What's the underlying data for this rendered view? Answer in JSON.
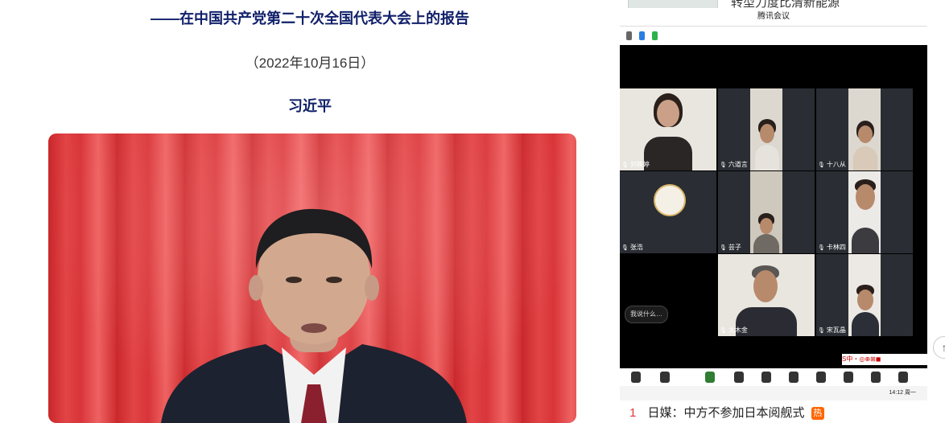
{
  "article": {
    "subtitle": "——在中国共产党第二十次全国代表大会上的报告",
    "date": "（2022年10月16日）",
    "author": "习近平"
  },
  "sidebar_news_top": {
    "title": "转型力度比清新能源"
  },
  "meeting": {
    "window_title": "腾讯会议",
    "participants": [
      {
        "name": "刘筱婷"
      },
      {
        "name": "六道言"
      },
      {
        "name": "十八从"
      },
      {
        "name": "张浩"
      },
      {
        "name": "芸子"
      },
      {
        "name": "卡林四"
      },
      {
        "name": "大木金"
      },
      {
        "name": "宋瓦晶"
      }
    ],
    "chat_label": "我说什么…",
    "clock": "14:12 周一"
  },
  "news_list": [
    {
      "rank": "1",
      "title": "日媒：中方不参加日本阅舰式",
      "badge": "热"
    }
  ],
  "colors": {
    "headline": "#11206a",
    "rank": "#e03838",
    "hot_badge": "#ff6600"
  }
}
